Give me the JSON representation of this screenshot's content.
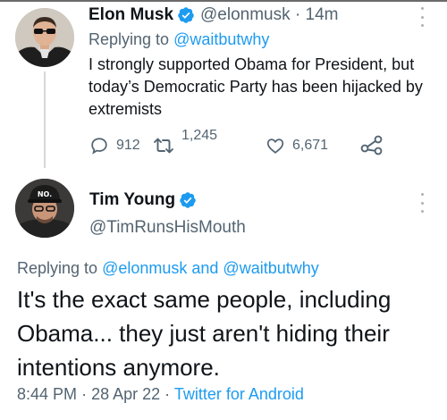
{
  "tweet1": {
    "author_name": "Elon Musk",
    "handle_time": "@elonmusk · 14m",
    "reply_prefix": "Replying to",
    "reply_handle": "@waitbutwhy",
    "text": "I strongly supported Obama for President, but today’s Democratic Party has been hijacked by extremists",
    "replies": "912",
    "retweets": "1,245",
    "likes": "6,671",
    "verified_icon": "verified-badge-icon",
    "reply_icon": "speech-bubble-icon",
    "retweet_icon": "retweet-arrows-icon",
    "like_icon": "heart-icon",
    "share_icon": "share-nodes-icon"
  },
  "tweet2": {
    "author_name": "Tim Young",
    "handle": "@TimRunsHisMouth",
    "reply_prefix": "Replying to",
    "reply_handles": "@elonmusk and @waitbutwhy",
    "text": "It's the exact same people, including Obama... they just aren't hiding their intentions anymore.",
    "time": "8:44 PM",
    "date": "28 Apr 22",
    "source": "Twitter for Android",
    "hat_text": "NO."
  },
  "colors": {
    "text_primary": "#0f1419",
    "text_secondary": "#536471",
    "accent": "#1d9bf0",
    "divider": "#d4d8db"
  }
}
